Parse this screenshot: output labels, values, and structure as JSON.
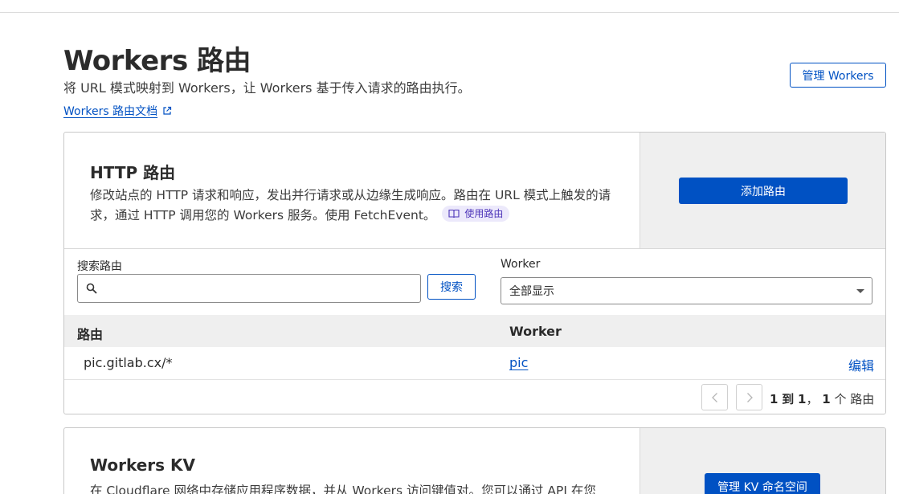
{
  "header": {
    "title": "Workers 路由",
    "subtitle": "将 URL 模式映射到 Workers，让 Workers 基于传入请求的路由执行。",
    "docs_link": "Workers 路由文档",
    "manage_button": "管理 Workers"
  },
  "http_card": {
    "title": "HTTP 路由",
    "description": "修改站点的 HTTP 请求和响应，发出并行请求或从边缘生成响应。路由在 URL 模式上触发的请求，通过 HTTP 调用您的 Workers 服务。使用 FetchEvent。",
    "pill_label": "使用路由",
    "add_button": "添加路由",
    "search_label": "搜索路由",
    "search_placeholder": "",
    "search_button": "搜索",
    "worker_filter_label": "Worker",
    "worker_filter_value": "全部显示",
    "table": {
      "columns": [
        "路由",
        "Worker"
      ],
      "rows": [
        {
          "route": "pic.gitlab.cx/*",
          "worker": "pic",
          "action": "编辑"
        }
      ]
    },
    "pagination": {
      "from": "1",
      "to_word": "到",
      "to": "1",
      "total": "1",
      "unit": "个 路由"
    }
  },
  "kv_card": {
    "title": "Workers KV",
    "description": "在 Cloudflare 网络中存储应用程序数据，并从 Workers 访问键值对。您可以通过 API 在您",
    "button": "管理 KV 命名空间"
  },
  "colors": {
    "accent": "#0051c3",
    "pill_bg": "#ece9fb",
    "pill_text": "#4d35b9",
    "panel_bg": "#efefef"
  },
  "icons": [
    "external-link-icon",
    "book-icon",
    "search-icon",
    "chevron-left-icon",
    "chevron-right-icon",
    "caret-down-icon"
  ]
}
